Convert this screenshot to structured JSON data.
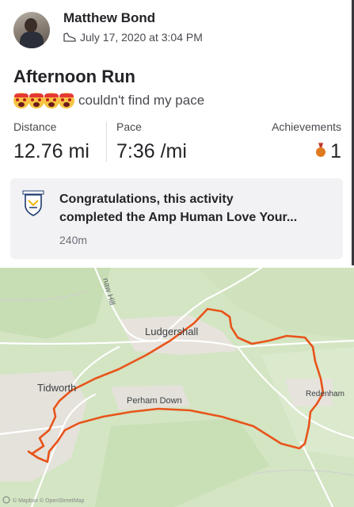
{
  "athlete": {
    "name": "Matthew Bond",
    "datetime": "July 17, 2020 at 3:04 PM"
  },
  "activity": {
    "title": "Afternoon Run",
    "description": "couldn't find my pace",
    "emoji_icons": [
      "scream-emoji-icon",
      "scream-emoji-icon",
      "scream-emoji-icon",
      "scream-emoji-icon"
    ]
  },
  "stats": {
    "distance_label": "Distance",
    "distance_value": "12.76 mi",
    "pace_label": "Pace",
    "pace_value": "7:36 /mi",
    "achievements_label": "Achievements",
    "achievements_value": "1"
  },
  "challenge": {
    "text_line1": "Congratulations, this activity",
    "text_line2": "completed the Amp Human Love Your...",
    "sub": "240m"
  },
  "map": {
    "labels": {
      "road": "naw Hill",
      "town1": "Ludgershall",
      "town2": "Tidworth",
      "town3": "Perham Down",
      "town4": "Redenham"
    },
    "attribution": "© Mapbox © OpenStreetMap",
    "route_color": "#e8541a"
  }
}
